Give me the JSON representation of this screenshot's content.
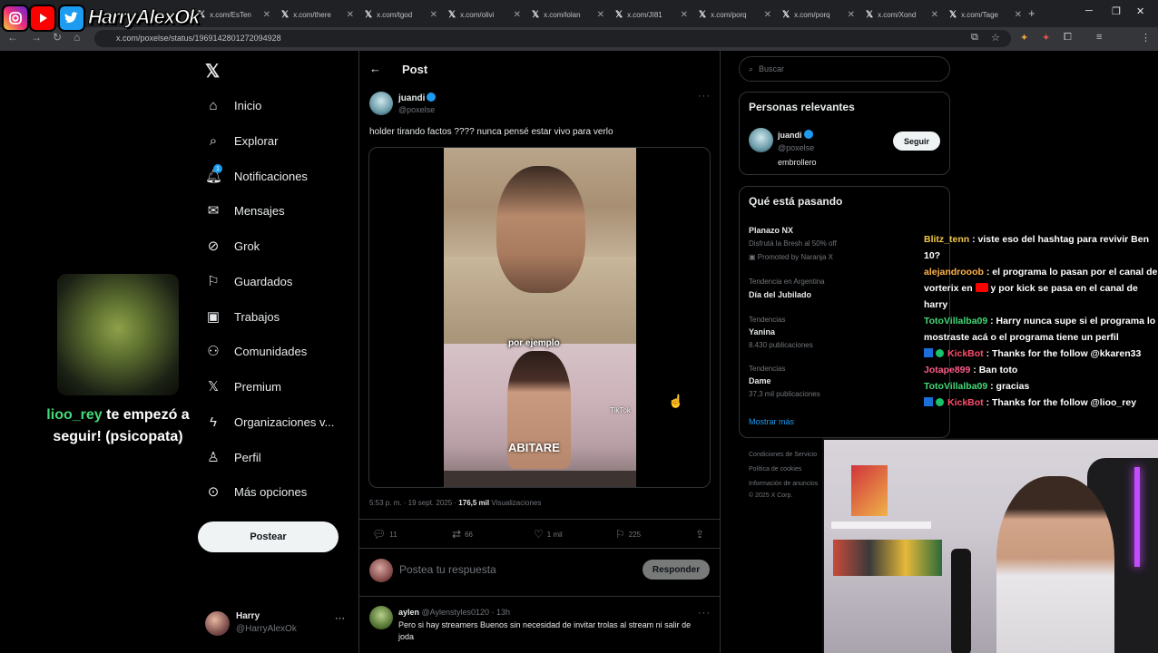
{
  "overlay": {
    "channel_name": "HarryAlexOk",
    "follow_user": "lioo_rey",
    "follow_message": "te empezó a seguir! (psicopata)"
  },
  "browser": {
    "tabs": [
      "x.com/EsTen",
      "x.com/there",
      "x.com/tgod",
      "x.com/olivi",
      "x.com/lolan",
      "x.com/JI81",
      "x.com/porq",
      "x.com/porq",
      "x.com/Xond",
      "x.com/Tage"
    ],
    "url": "x.com/poxelse/status/1969142801272094928"
  },
  "nav": {
    "items": [
      "Inicio",
      "Explorar",
      "Notificaciones",
      "Mensajes",
      "Grok",
      "Guardados",
      "Trabajos",
      "Comunidades",
      "Premium",
      "Organizaciones v...",
      "Perfil",
      "Más opciones"
    ],
    "notif_count": "1",
    "post_button": "Postear",
    "account_name": "Harry",
    "account_handle": "@HarryAlexOk"
  },
  "post": {
    "header": "Post",
    "author_name": "juandi",
    "author_handle": "@poxelse",
    "text": "holder tirando factos ???? nunca pensé estar vivo para verlo",
    "video_caption": "por ejemplo",
    "video_logo": "ABITARE",
    "video_watermark": "TikTok",
    "time": "5:53 p. m. · 19 sept. 2025 ·",
    "views_count": "176,5 mil",
    "views_label": "Visualizaciones",
    "replies": "11",
    "reposts": "66",
    "likes": "1 mil",
    "bookmarks": "225",
    "reply_placeholder": "Postea tu respuesta",
    "reply_button": "Responder"
  },
  "comment": {
    "name": "aylen",
    "handle": "@Aylenstyles0120 · 13h",
    "text": "Pero si hay streamers Buenos sin necesidad de invitar trolas al stream ni salir de joda"
  },
  "sidebar": {
    "search_placeholder": "Buscar",
    "relevant_title": "Personas relevantes",
    "relevant_name": "juandi",
    "relevant_handle": "@poxelse",
    "relevant_bio": "embrollero",
    "follow_button": "Seguir",
    "trends_title": "Qué está pasando",
    "trends": [
      {
        "category": "",
        "name": "Planazo NX",
        "sub": "Disfrutá la Bresh al 50% off"
      },
      {
        "category": "Tendencia en Argentina",
        "name": "Día del Jubilado",
        "sub": ""
      },
      {
        "category": "Tendencias",
        "name": "Yanina",
        "sub": "8.430 publicaciones"
      },
      {
        "category": "Tendencias",
        "name": "Dame",
        "sub": "37,3 mil publicaciones"
      }
    ],
    "promoted": "Promoted by Naranja X",
    "show_more": "Mostrar más",
    "footer": [
      "Condiciones de Servicio",
      "Política de cookies",
      "Información de anuncios",
      "© 2025 X Corp."
    ]
  },
  "chat": [
    {
      "user": "Blitz_tenn",
      "msg": ": viste eso del hashtag para revivir Ben 10?"
    },
    {
      "user": "alejandrooob",
      "msg": ": el programa lo pasan por el canal de vorterix en",
      "msg2": "y por kick se pasa en el canal de harry"
    },
    {
      "user": "TotoVillalba09",
      "msg": ": Harry nunca supe si el programa lo mostraste acá o el programa tiene un perfil"
    },
    {
      "user": "KickBot",
      "msg": ": Thanks for the follow @kkaren33"
    },
    {
      "user": "Jotape899",
      "msg": ": Ban toto"
    },
    {
      "user": "TotoVillalba09",
      "msg": ": gracias"
    },
    {
      "user": "KickBot",
      "msg": ": Thanks for the follow @lioo_rey"
    }
  ],
  "colors": {
    "accent": "#1d9bf0",
    "background": "#000000",
    "follow_user": "#44d977"
  }
}
